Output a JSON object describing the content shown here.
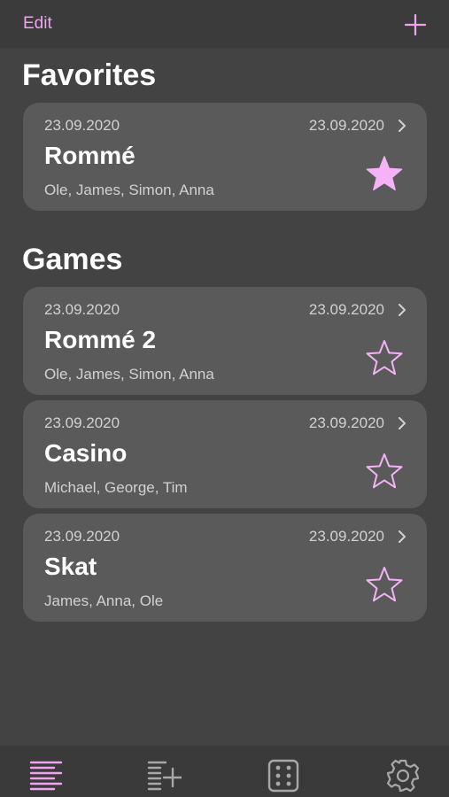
{
  "nav": {
    "edit_label": "Edit",
    "add_icon": "plus-icon"
  },
  "colors": {
    "accent": "#f0a4f0",
    "background": "#434343",
    "card": "#5a5a5a",
    "tab_inactive": "#a8a8a8"
  },
  "sections": {
    "favorites_title": "Favorites",
    "games_title": "Games"
  },
  "favorites": [
    {
      "date_start": "23.09.2020",
      "date_end": "23.09.2020",
      "title": "Rommé",
      "players": "Ole, James, Simon, Anna",
      "favorite": true
    }
  ],
  "games": [
    {
      "date_start": "23.09.2020",
      "date_end": "23.09.2020",
      "title": "Rommé 2",
      "players": "Ole, James, Simon, Anna",
      "favorite": false
    },
    {
      "date_start": "23.09.2020",
      "date_end": "23.09.2020",
      "title": "Casino",
      "players": "Michael, George, Tim",
      "favorite": false
    },
    {
      "date_start": "23.09.2020",
      "date_end": "23.09.2020",
      "title": "Skat",
      "players": "James, Anna, Ole",
      "favorite": false
    }
  ],
  "tabbar": {
    "tabs": [
      {
        "icon": "list-icon",
        "selected": true
      },
      {
        "icon": "add-list-icon",
        "selected": false
      },
      {
        "icon": "dice-icon",
        "selected": false
      },
      {
        "icon": "gear-icon",
        "selected": false
      }
    ]
  }
}
